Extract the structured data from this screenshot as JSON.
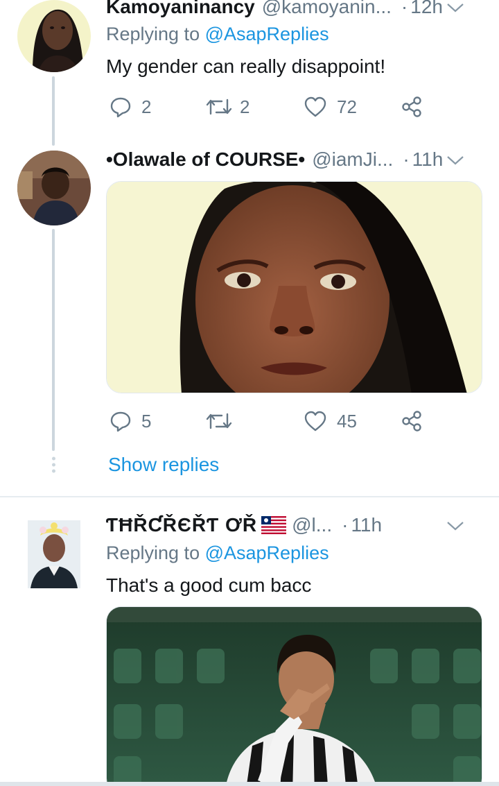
{
  "tweets": [
    {
      "name": "Kamoyaninancy",
      "handle": "@kamoyanin...",
      "dot": "·",
      "time": "12h",
      "replying_prefix": "Replying to ",
      "replying_to": "@AsapReplies",
      "text": "My gender can really disappoint!",
      "replies": "2",
      "retweets": "2",
      "likes": "72"
    },
    {
      "name": "•Olawale of COURSE•",
      "handle": "@iamJi...",
      "dot": "·",
      "time": "11h",
      "replies": "5",
      "retweets": "",
      "likes": "45",
      "show_replies": "Show replies"
    },
    {
      "name": "ƬĦŘƇŘЄŘƬ ƠŘ",
      "handle": "@l...",
      "dot": "·",
      "time": "11h",
      "replying_prefix": "Replying to ",
      "replying_to": "@AsapReplies",
      "text": "That's a good cum bacc"
    }
  ],
  "colors": {
    "accent": "#1b95e0",
    "secondary_text": "#657786",
    "primary_text": "#14171a",
    "thread_line": "#ccd6dd"
  },
  "icons": {
    "reply": "reply-icon",
    "retweet": "retweet-icon",
    "like": "heart-icon",
    "share": "share-icon",
    "caret": "chevron-down-icon",
    "flag": "liberia-flag-icon"
  }
}
